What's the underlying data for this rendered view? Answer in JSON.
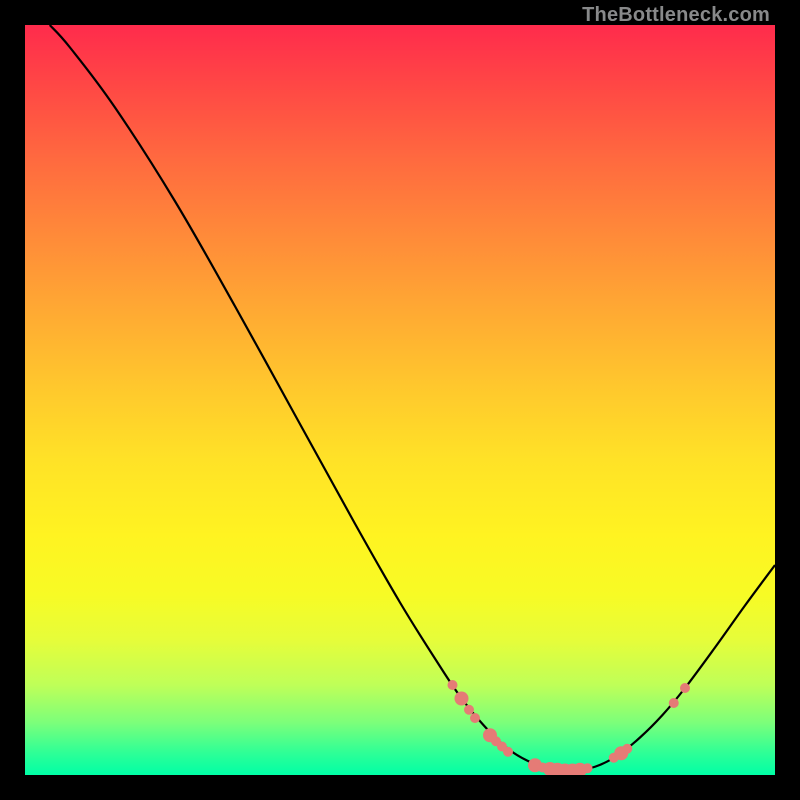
{
  "watermark": "TheBottleneck.com",
  "chart_data": {
    "type": "line",
    "title": "",
    "xlabel": "",
    "ylabel": "",
    "xlim": [
      0,
      100
    ],
    "ylim": [
      0,
      100
    ],
    "curve": [
      {
        "x": 3.3,
        "y": 100.0
      },
      {
        "x": 6.0,
        "y": 97.0
      },
      {
        "x": 12.0,
        "y": 89.0
      },
      {
        "x": 20.0,
        "y": 76.5
      },
      {
        "x": 28.0,
        "y": 62.5
      },
      {
        "x": 36.0,
        "y": 48.0
      },
      {
        "x": 44.0,
        "y": 33.5
      },
      {
        "x": 50.0,
        "y": 23.0
      },
      {
        "x": 55.0,
        "y": 15.0
      },
      {
        "x": 58.0,
        "y": 10.5
      },
      {
        "x": 61.0,
        "y": 6.8
      },
      {
        "x": 64.0,
        "y": 3.8
      },
      {
        "x": 67.0,
        "y": 1.9
      },
      {
        "x": 70.0,
        "y": 0.9
      },
      {
        "x": 73.0,
        "y": 0.6
      },
      {
        "x": 76.0,
        "y": 1.1
      },
      {
        "x": 79.0,
        "y": 2.6
      },
      {
        "x": 82.0,
        "y": 5.0
      },
      {
        "x": 85.0,
        "y": 8.0
      },
      {
        "x": 88.0,
        "y": 11.6
      },
      {
        "x": 92.0,
        "y": 17.0
      },
      {
        "x": 96.0,
        "y": 22.6
      },
      {
        "x": 100.0,
        "y": 28.0
      }
    ],
    "markers": [
      {
        "x": 57.0,
        "y": 12.0,
        "r": 5
      },
      {
        "x": 58.2,
        "y": 10.2,
        "r": 7
      },
      {
        "x": 59.2,
        "y": 8.7,
        "r": 5
      },
      {
        "x": 60.0,
        "y": 7.6,
        "r": 5
      },
      {
        "x": 62.0,
        "y": 5.3,
        "r": 7
      },
      {
        "x": 62.8,
        "y": 4.5,
        "r": 5
      },
      {
        "x": 63.6,
        "y": 3.8,
        "r": 5
      },
      {
        "x": 64.4,
        "y": 3.1,
        "r": 5
      },
      {
        "x": 68.0,
        "y": 1.3,
        "r": 7
      },
      {
        "x": 69.0,
        "y": 1.0,
        "r": 5
      },
      {
        "x": 70.0,
        "y": 0.8,
        "r": 7
      },
      {
        "x": 71.0,
        "y": 0.7,
        "r": 7
      },
      {
        "x": 72.0,
        "y": 0.6,
        "r": 7
      },
      {
        "x": 73.0,
        "y": 0.6,
        "r": 7
      },
      {
        "x": 74.0,
        "y": 0.7,
        "r": 7
      },
      {
        "x": 75.0,
        "y": 0.9,
        "r": 5
      },
      {
        "x": 78.5,
        "y": 2.3,
        "r": 5
      },
      {
        "x": 79.5,
        "y": 2.9,
        "r": 7
      },
      {
        "x": 80.3,
        "y": 3.5,
        "r": 5
      },
      {
        "x": 86.5,
        "y": 9.6,
        "r": 5
      },
      {
        "x": 88.0,
        "y": 11.6,
        "r": 5
      }
    ],
    "colors": {
      "curve": "#000000",
      "marker": "#e57b76",
      "gradient_top": "#ff2b4c",
      "gradient_bottom": "#00ffa6"
    }
  }
}
